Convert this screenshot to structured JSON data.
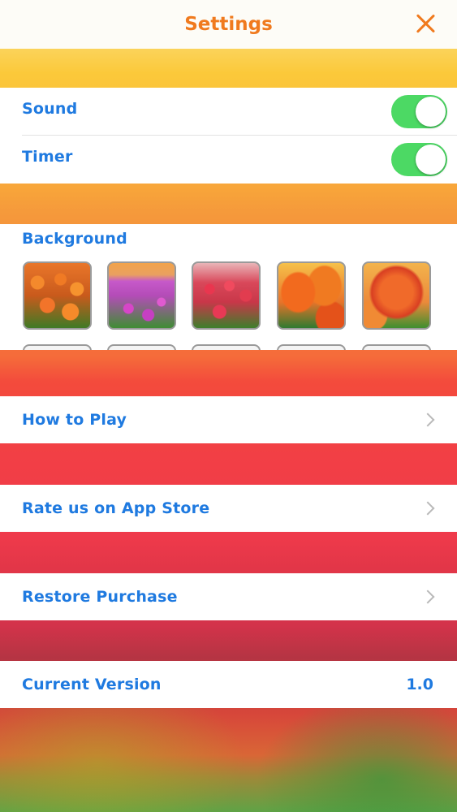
{
  "header": {
    "title": "Settings",
    "close_icon": "close-icon"
  },
  "settings": {
    "sound": {
      "label": "Sound",
      "enabled": true
    },
    "timer": {
      "label": "Timer",
      "enabled": true
    }
  },
  "background": {
    "label": "Background",
    "options": [
      "tulip-field-orange",
      "tulip-field-purple",
      "tulip-field-red",
      "tulip-closeup-orange",
      "tulip-closeup-red"
    ]
  },
  "menu": {
    "how_to_play": "How to Play",
    "rate_us": "Rate us on App Store",
    "restore_purchase": "Restore Purchase"
  },
  "version": {
    "label": "Current Version",
    "value": "1.0"
  },
  "colors": {
    "accent": "#f07a1e",
    "label_blue": "#1f7ae0",
    "toggle_on": "#4cd964"
  }
}
